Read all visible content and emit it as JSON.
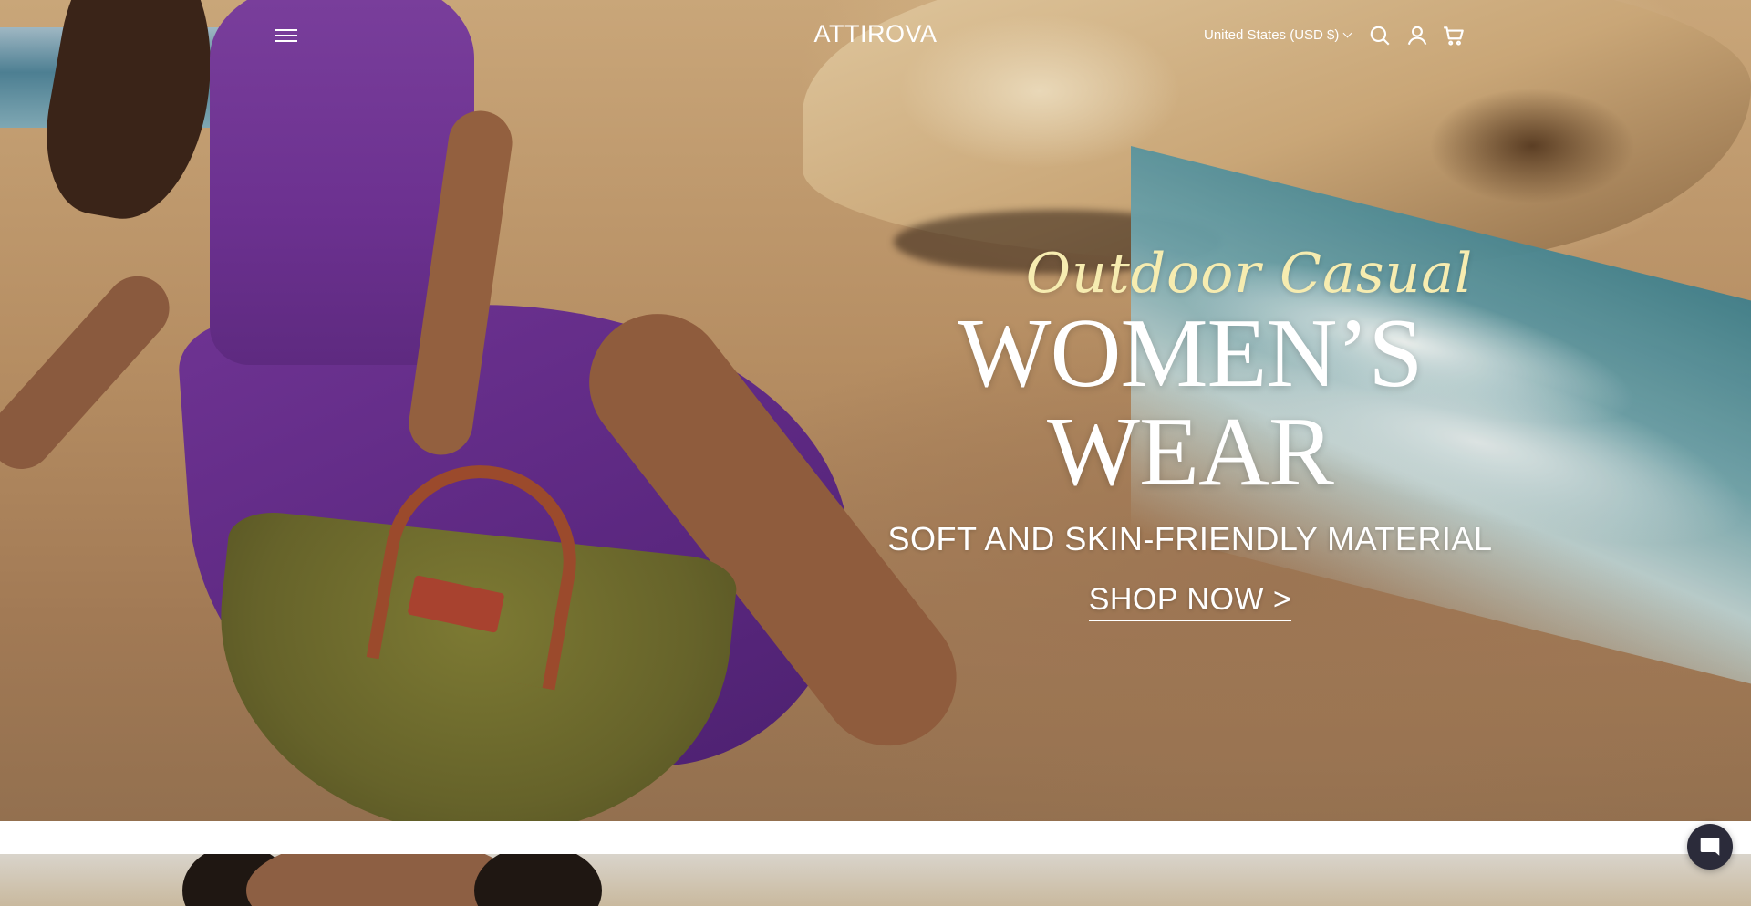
{
  "header": {
    "brand": "ATTIROVA",
    "country_selector": "United States (USD $)",
    "icons": [
      "menu-icon",
      "search-icon",
      "account-icon",
      "cart-icon"
    ]
  },
  "hero": {
    "tagline": "Outdoor Casual",
    "headline": "WOMEN’S WEAR",
    "subheadline": "SOFT AND SKIN-FRIENDLY MATERIAL",
    "cta_label": "SHOP NOW >"
  },
  "chat": {
    "icon": "chat-bubble-icon"
  },
  "colors": {
    "tagline": "#f6ecb0",
    "text": "#ffffff",
    "chat_button": "#2b2b3a"
  }
}
